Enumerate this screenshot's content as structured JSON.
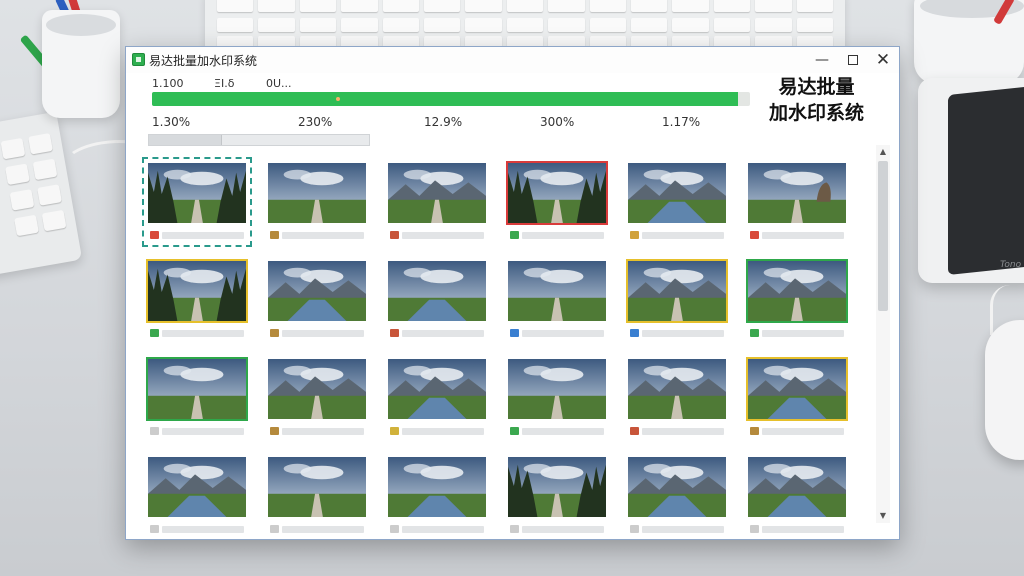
{
  "window": {
    "title": "易达批量加水印系统",
    "overlay_title_line1": "易达批量",
    "overlay_title_line2": "加水印系统",
    "controls": {
      "minimize": "—",
      "close": "✕"
    }
  },
  "stats_row1": [
    "1.100",
    "ΞΙ.δ",
    "0U..."
  ],
  "progress": {
    "fraction": 0.98,
    "color": "#2fbd55"
  },
  "stats_row2": [
    "1.30%",
    "230%",
    "12.9%",
    "300%",
    "1.17%"
  ],
  "sub_progress": {
    "fraction": 0.33
  },
  "thumbnails": [
    {
      "scene": "forest-road",
      "selection": "dashed",
      "icon_color": "#d94a3a"
    },
    {
      "scene": "field-road",
      "selection": "none",
      "icon_color": "#b58a3c"
    },
    {
      "scene": "mountain-field",
      "selection": "none",
      "icon_color": "#c8553a"
    },
    {
      "scene": "forest-road",
      "selection": "red",
      "icon_color": "#3ba84f"
    },
    {
      "scene": "lake-mountain",
      "selection": "none",
      "icon_color": "#d1a23b"
    },
    {
      "scene": "rock-road",
      "selection": "none",
      "icon_color": "#d94a3a"
    },
    {
      "scene": "forest-road",
      "selection": "yellow",
      "icon_color": "#3ba84f"
    },
    {
      "scene": "lake-mountain",
      "selection": "none",
      "icon_color": "#b58a3c"
    },
    {
      "scene": "river-field",
      "selection": "none",
      "icon_color": "#c8553a"
    },
    {
      "scene": "field-road",
      "selection": "none",
      "icon_color": "#3a7fd1"
    },
    {
      "scene": "mountain-road",
      "selection": "yellow",
      "icon_color": "#3a7fd1"
    },
    {
      "scene": "mountain-road",
      "selection": "green",
      "icon_color": "#3ba84f"
    },
    {
      "scene": "field-road",
      "selection": "green",
      "icon_color": "#cccccc"
    },
    {
      "scene": "mountain-road",
      "selection": "none",
      "icon_color": "#b58a3c"
    },
    {
      "scene": "lake-mountain",
      "selection": "none",
      "icon_color": "#d1b23b"
    },
    {
      "scene": "field-road",
      "selection": "none",
      "icon_color": "#3ba84f"
    },
    {
      "scene": "mountain-road",
      "selection": "none",
      "icon_color": "#c8553a"
    },
    {
      "scene": "lake-mountain",
      "selection": "yellow",
      "icon_color": "#b58a3c"
    },
    {
      "scene": "lake-mountain",
      "selection": "none",
      "icon_color": "#cccccc"
    },
    {
      "scene": "field-road",
      "selection": "none",
      "icon_color": "#cccccc"
    },
    {
      "scene": "river-field",
      "selection": "none",
      "icon_color": "#cccccc"
    },
    {
      "scene": "forest-road",
      "selection": "none",
      "icon_color": "#cccccc"
    },
    {
      "scene": "lake-mountain",
      "selection": "none",
      "icon_color": "#cccccc"
    },
    {
      "scene": "lake-mountain",
      "selection": "none",
      "icon_color": "#cccccc"
    }
  ],
  "scrollbar": {
    "up": "▲",
    "down": "▼",
    "position": 0.0
  },
  "desk": {
    "dock_brand": "Tono"
  }
}
